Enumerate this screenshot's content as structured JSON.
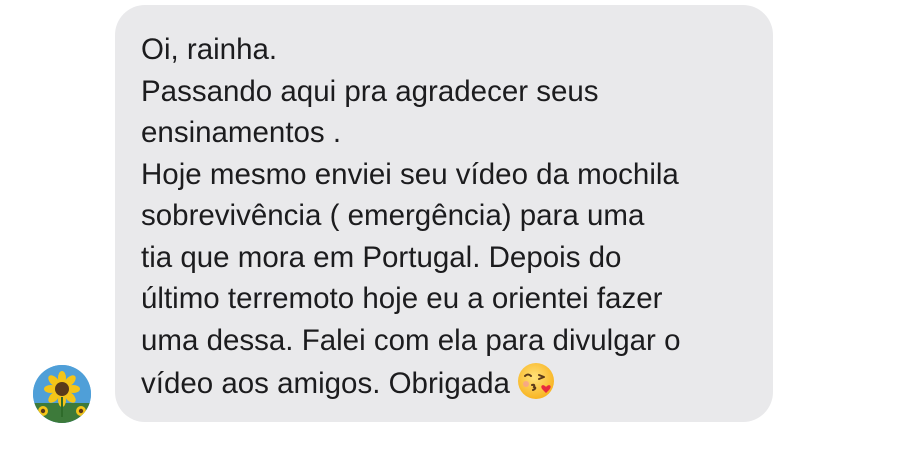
{
  "message": {
    "lines": [
      "Oi, rainha.",
      "Passando aqui pra agradecer seus",
      "ensinamentos .",
      "Hoje mesmo enviei seu vídeo da mochila",
      "sobrevivência ( emergência) para uma",
      "tia que mora em Portugal. Depois do",
      "último terremoto hoje eu a orientei fazer",
      "uma dessa. Falei com ela para divulgar o",
      "vídeo aos amigos. Obrigada"
    ],
    "emoji": "face-blowing-a-kiss-icon"
  },
  "avatar": {
    "icon": "sunflower-avatar-icon"
  },
  "colors": {
    "bubble": "#e9e9eb",
    "text": "#1c1c1e",
    "background": "#ffffff"
  }
}
